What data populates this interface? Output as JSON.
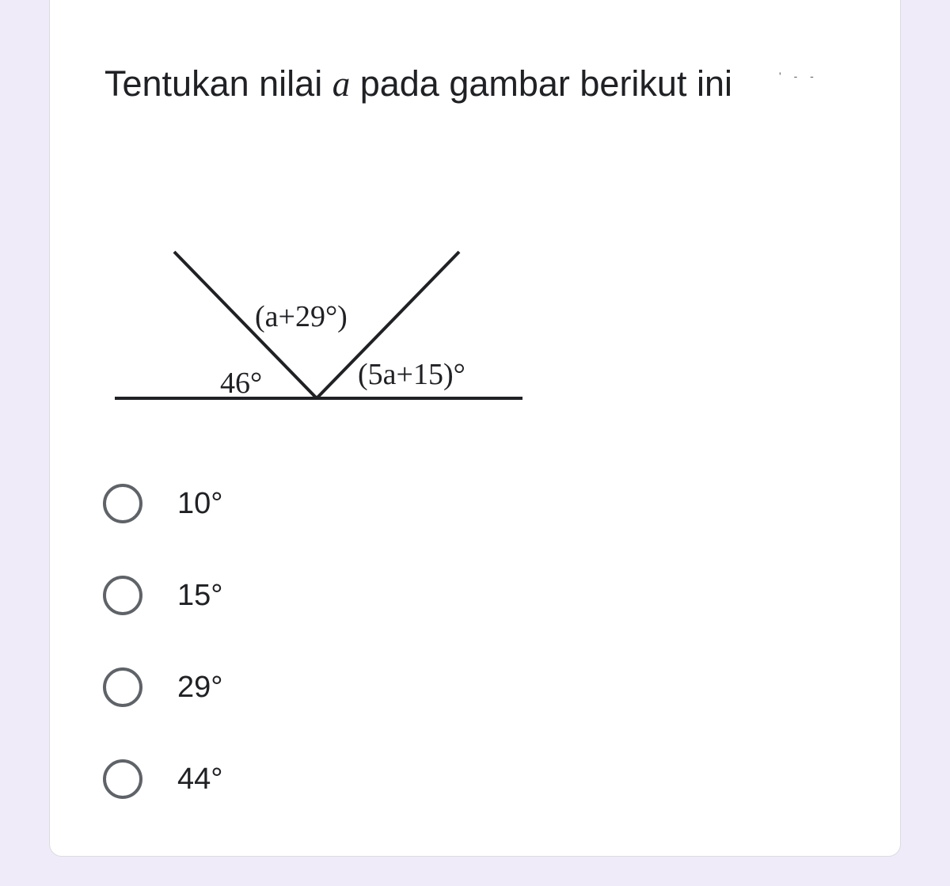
{
  "question": {
    "title_before": "Tentukan nilai ",
    "title_var": "a",
    "title_after": " pada gambar berikut ini",
    "corner_marks": "' - -"
  },
  "figure": {
    "label_top": "(a+29°)",
    "label_left": "46°",
    "label_right": "(5a+15)°"
  },
  "options": [
    {
      "label": "10°"
    },
    {
      "label": "15°"
    },
    {
      "label": "29°"
    },
    {
      "label": "44°"
    }
  ],
  "colors": {
    "background": "#f0ebf8",
    "card": "#ffffff",
    "text": "#202124",
    "radio_border": "#5f6368"
  }
}
